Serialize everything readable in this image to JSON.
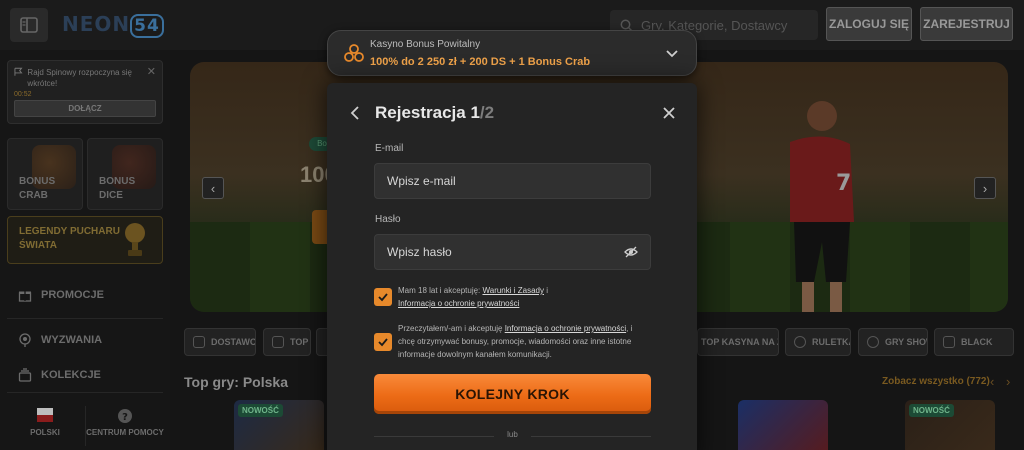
{
  "header": {
    "logo_text": "NEON",
    "logo_number": "54",
    "search_placeholder": "Gry, Kategorie, Dostawcy",
    "login_label": "ZALOGUJ SIĘ",
    "register_label": "ZAREJESTRUJ"
  },
  "sidebar": {
    "notification": {
      "text": "Rajd Spinowy rozpoczyna się wkrótce!",
      "time": "00:52",
      "join_label": "DOŁĄCZ"
    },
    "tiles": [
      {
        "line1": "BONUS",
        "line2": "CRAB"
      },
      {
        "line1": "BONUS",
        "line2": "DICE"
      }
    ],
    "legend_tile": {
      "line1": "LEGENDY PUCHARU",
      "line2": "ŚWIATA"
    },
    "links": [
      {
        "label": "PROMOCJE",
        "icon": "gift-icon"
      },
      {
        "label": "WYZWANIA",
        "icon": "target-icon"
      },
      {
        "label": "KOLEKCJE",
        "icon": "collection-icon"
      }
    ],
    "footer": {
      "language": "POLSKI",
      "help": "CENTRUM POMOCY"
    }
  },
  "banner": {
    "badge": "Bo",
    "big_text": "100"
  },
  "categories": [
    {
      "label": "DOSTAWCY",
      "icon": "provider-icon"
    },
    {
      "label": "TOP",
      "icon": "crown-icon"
    },
    {
      "label": "TOP KASYNA NA ŻYWO",
      "icon": "live-icon"
    },
    {
      "label": "RULETKA",
      "icon": "roulette-icon"
    },
    {
      "label": "GRY SHOW",
      "icon": "microphone-icon"
    },
    {
      "label": "BLACK",
      "icon": "cards-icon"
    }
  ],
  "games_section": {
    "title": "Top gry: Polska",
    "see_all": "Zobacz wszystko (772)",
    "new_badge": "NOWOŚĆ"
  },
  "bonus_selector": {
    "label": "Kasyno Bonus Powitalny",
    "value": "100% do 2 250 zł + 200 DS + 1 Bonus Crab"
  },
  "registration": {
    "title_main": "Rejestracja 1",
    "title_slash": "/2",
    "email_label": "E-mail",
    "email_placeholder": "Wpisz e-mail",
    "password_label": "Hasło",
    "password_placeholder": "Wpisz hasło",
    "consent1": {
      "text_before": "Mam 18 lat i akceptuję: ",
      "link1": "Warunki i Zasady",
      "text_mid": " i ",
      "link2": "Informacja o ochronie prywatności"
    },
    "consent2": {
      "text_before": "Przeczytałem/-am i akceptuję ",
      "link": "Informacja o ochronie prywatności",
      "text_after": ", i chcę otrzymywać bonusy, promocje, wiadomości oraz inne istotne informacje dowolnym kanałem komunikacji."
    },
    "submit_label": "KOLEJNY KROK",
    "or_label": "lub"
  }
}
